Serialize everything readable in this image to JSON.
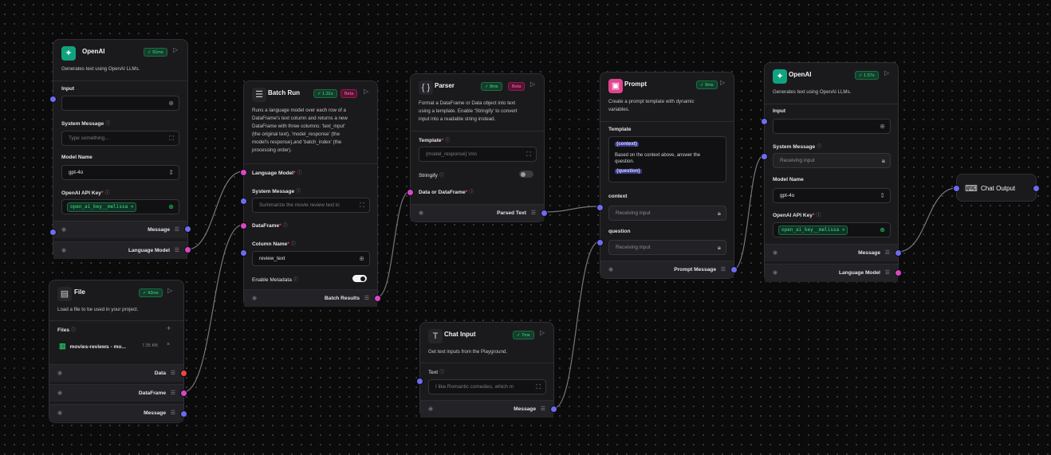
{
  "colors": {
    "blue_handle": "#6d6cf0",
    "pink_handle": "#d946c7",
    "red_handle": "#ef4444",
    "success": "#4ade80",
    "beta": "#f472b6"
  },
  "openai1": {
    "title": "OpenAI",
    "time": "91ms",
    "icon": "openai-icon",
    "desc": "Generates text using OpenAI LLMs.",
    "input_label": "Input",
    "input_value": "",
    "system_label": "System Message",
    "system_placeholder": "Type something...",
    "model_label": "Model Name",
    "model_value": "gpt-4o",
    "key_label": "OpenAI API Key",
    "key_chip": "open_ai_key__melissa",
    "out_message": "Message",
    "out_lm": "Language Model"
  },
  "file": {
    "title": "File",
    "time": "42ms",
    "icon": "file-icon",
    "desc": "Load a file to be used in your project.",
    "files_label": "Files",
    "file_name": "movies-reviews - mo...",
    "file_size": "7.35 KB",
    "out_data": "Data",
    "out_dataframe": "DataFrame",
    "out_message": "Message"
  },
  "batch": {
    "title": "Batch Run",
    "time": "1.31s",
    "beta": "Beta",
    "desc_lines": [
      "Runs a language model over each row of a",
      "DataFrame's text column and returns a new",
      "DataFrame with three columns: 'text_input'",
      "(the original text), 'model_response' (the",
      "model's response),and 'batch_index' (the",
      "processing order)."
    ],
    "lm_label": "Language Model",
    "system_label": "System Message",
    "system_placeholder": "Summarize the movie review text in",
    "df_label": "DataFrame",
    "col_label": "Column Name",
    "col_value": "review_text",
    "meta_label": "Enable Metadata",
    "out_results": "Batch Results"
  },
  "parser": {
    "title": "Parser",
    "time": "8ms",
    "beta": "Beta",
    "desc_lines": [
      "Format a DataFrame or Data object into text",
      "using a template. Enable 'Stringify' to convert",
      "input into a readable string instead."
    ],
    "template_label": "Template",
    "template_value": "{model_response} \\n\\n",
    "stringify_label": "Stringify",
    "data_label": "Data or DataFrame",
    "out_parsed": "Parsed Text"
  },
  "prompt": {
    "title": "Prompt",
    "time": "9ms",
    "desc_lines": [
      "Create a prompt template with dynamic",
      "variables."
    ],
    "template_label": "Template",
    "template_var1": "{context}",
    "template_body": "Based on the context above, answer the question.",
    "template_var2": "{question}",
    "context_label": "context",
    "context_placeholder": "Receiving input",
    "question_label": "question",
    "question_placeholder": "Receiving input",
    "out_prompt": "Prompt Message"
  },
  "openai2": {
    "title": "OpenAI",
    "time": "1.57s",
    "desc": "Generates text using OpenAI LLMs.",
    "input_label": "Input",
    "input_value": "",
    "system_label": "System Message",
    "system_placeholder": "Receiving input",
    "model_label": "Model Name",
    "model_value": "gpt-4o",
    "key_label": "OpenAI API Key",
    "key_chip": "open_ai_key__melissa",
    "out_message": "Message",
    "out_lm": "Language Model"
  },
  "chat_input": {
    "title": "Chat Input",
    "time": "7ms",
    "desc": "Get text inputs from the Playground.",
    "text_label": "Text",
    "text_value": "I like Romantic comedies, which m",
    "out_message": "Message"
  },
  "chat_output": {
    "title": "Chat Output"
  }
}
